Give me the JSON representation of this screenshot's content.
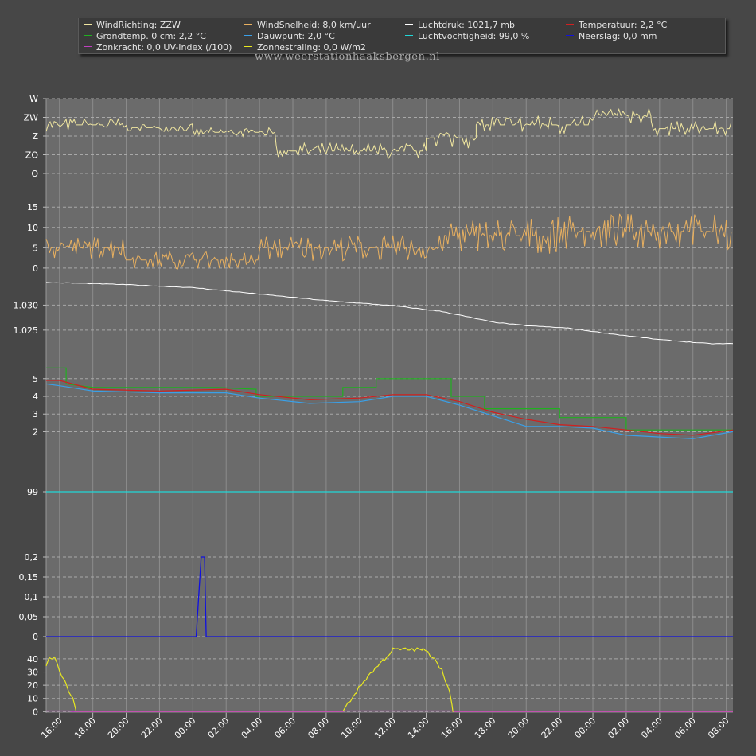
{
  "legend": [
    {
      "label": "WindRichting: ZZW",
      "color": "#f0e6a0"
    },
    {
      "label": "WindSnelheid: 8,0 km/uur",
      "color": "#e8b060"
    },
    {
      "label": "Luchtdruk: 1021,7 mb",
      "color": "#ffffff"
    },
    {
      "label": "Temperatuur: 2,2 °C",
      "color": "#d02020"
    },
    {
      "label": "Grondtemp. 0 cm: 2,2 °C",
      "color": "#20b020"
    },
    {
      "label": "Dauwpunt: 2,0 °C",
      "color": "#3aa0e8"
    },
    {
      "label": "Luchtvochtigheid: 99,0 %",
      "color": "#20d8d8"
    },
    {
      "label": "Neerslag: 0,0 mm",
      "color": "#1010e0"
    },
    {
      "label": "Zonkracht: 0,0 UV-Index (/100)",
      "color": "#c040c0"
    },
    {
      "label": "Zonnestraling: 0,0 W/m2",
      "color": "#e8e820"
    }
  ],
  "watermark": "www.weerstationhaaksbergen.nl",
  "colors": {
    "page_bg": "#474747",
    "panel_bg": "#6b6b6b",
    "grid": "#8c8c8c",
    "text": "#ffffff"
  },
  "chart_data": [
    {
      "type": "line",
      "name": "winddirection",
      "series_name": "WindRichting",
      "color": "#f0e6a0",
      "ytick_labels": [
        "O",
        "ZO",
        "Z",
        "ZW",
        "W"
      ],
      "ylim": [
        0,
        4
      ],
      "x_start_hour": 15.2,
      "x_end_hour": 56.4,
      "x_tick_labels": [
        "16:00",
        "18:00",
        "20:00",
        "22:00",
        "00:00",
        "02:00",
        "04:00",
        "06:00",
        "08:00",
        "10:00",
        "12:00",
        "14:00",
        "16:00",
        "18:00",
        "20:00",
        "22:00",
        "00:00",
        "02:00",
        "04:00",
        "06:00",
        "08:00"
      ],
      "segments": [
        {
          "x0": 15.2,
          "x1": 20.0,
          "level": 2.6,
          "noise": 0.35
        },
        {
          "x0": 20.0,
          "x1": 24.0,
          "level": 2.45,
          "noise": 0.2
        },
        {
          "x0": 24.0,
          "x1": 29.0,
          "level": 2.2,
          "noise": 0.25
        },
        {
          "x0": 29.0,
          "x1": 38.0,
          "level": 1.2,
          "noise": 0.45
        },
        {
          "x0": 38.0,
          "x1": 41.0,
          "level": 1.9,
          "noise": 0.55
        },
        {
          "x0": 41.0,
          "x1": 48.0,
          "level": 2.6,
          "noise": 0.55
        },
        {
          "x0": 48.0,
          "x1": 51.5,
          "level": 3.1,
          "noise": 0.45
        },
        {
          "x0": 51.5,
          "x1": 56.4,
          "level": 2.4,
          "noise": 0.4
        }
      ]
    },
    {
      "type": "line",
      "name": "windspeed",
      "series_name": "WindSnelheid",
      "color": "#e8b060",
      "yticks": [
        0,
        5,
        10,
        15
      ],
      "ylim": [
        -1,
        17
      ],
      "x_start_hour": 15.2,
      "x_end_hour": 56.4,
      "segments": [
        {
          "x0": 15.2,
          "x1": 20.0,
          "level": 5,
          "noise": 2.8
        },
        {
          "x0": 20.0,
          "x1": 28.0,
          "level": 2,
          "noise": 2.2
        },
        {
          "x0": 28.0,
          "x1": 39.0,
          "level": 5,
          "noise": 3.2
        },
        {
          "x0": 39.0,
          "x1": 46.0,
          "level": 8,
          "noise": 4.5
        },
        {
          "x0": 46.0,
          "x1": 56.4,
          "level": 9,
          "noise": 4.5
        }
      ]
    },
    {
      "type": "line",
      "name": "pressure",
      "series_name": "Luchtdruk",
      "color": "#ffffff",
      "ytick_labels": [
        "1.025",
        "1.030"
      ],
      "yticks": [
        1025,
        1030
      ],
      "ylim": [
        1021,
        1035
      ],
      "x": [
        15.2,
        17,
        20,
        24,
        28,
        32,
        36,
        39,
        42,
        44,
        46.5,
        49,
        52,
        55,
        56.4
      ],
      "values": [
        1034.5,
        1034.4,
        1034.1,
        1033.5,
        1032.2,
        1030.9,
        1029.9,
        1028.7,
        1026.6,
        1025.9,
        1025.4,
        1024.3,
        1023.1,
        1022.3,
        1022.3
      ]
    },
    {
      "type": "line",
      "name": "temperatures",
      "yticks": [
        2,
        3,
        4,
        5
      ],
      "ylim": [
        0.4,
        5.8
      ],
      "series": [
        {
          "name": "Grondtemp.",
          "color": "#20b020",
          "x": [
            15.2,
            16.4,
            16.4,
            18,
            25,
            25.5,
            27.8,
            27.8,
            33,
            33,
            35,
            35,
            39.5,
            39.5,
            41.5,
            41.5,
            46,
            46,
            50,
            50,
            56.4
          ],
          "values": [
            5.6,
            5.6,
            4.7,
            4.5,
            4.5,
            4.5,
            4.4,
            4.0,
            4.0,
            4.5,
            4.5,
            5.0,
            5.0,
            4.0,
            4.0,
            3.3,
            3.3,
            2.8,
            2.8,
            2.1,
            2.1
          ]
        },
        {
          "name": "Temperatuur",
          "color": "#d02020",
          "x": [
            15.2,
            16,
            18,
            22,
            26,
            28,
            31,
            34,
            36,
            38,
            40,
            42,
            44,
            46,
            48,
            50,
            52,
            54,
            56.4
          ],
          "values": [
            4.9,
            4.9,
            4.4,
            4.3,
            4.4,
            4.1,
            3.8,
            3.9,
            4.1,
            4.1,
            3.7,
            3.1,
            2.7,
            2.4,
            2.3,
            2.1,
            1.9,
            1.8,
            2.1
          ]
        },
        {
          "name": "Dauwpunt",
          "color": "#3aa0e8",
          "x": [
            15.2,
            16,
            18,
            22,
            26,
            28,
            31,
            34,
            36,
            38,
            40,
            42,
            44,
            46,
            48,
            50,
            52,
            54,
            56.4
          ],
          "values": [
            4.7,
            4.6,
            4.3,
            4.2,
            4.2,
            3.9,
            3.6,
            3.7,
            4.0,
            4.0,
            3.5,
            2.9,
            2.3,
            2.3,
            2.2,
            1.8,
            1.7,
            1.6,
            2.0
          ]
        }
      ]
    },
    {
      "type": "line",
      "name": "humidity",
      "series_name": "Luchtvochtigheid",
      "color": "#20d8d8",
      "yticks": [
        99
      ],
      "ylim": [
        95,
        101
      ],
      "x": [
        15.2,
        56.4
      ],
      "values": [
        99,
        99
      ]
    },
    {
      "type": "line",
      "name": "rain",
      "series_name": "Neerslag",
      "color": "#1010e0",
      "ytick_labels": [
        "0",
        "0,05",
        "0,1",
        "0,15",
        "0,2"
      ],
      "yticks": [
        0,
        0.05,
        0.1,
        0.15,
        0.2
      ],
      "ylim": [
        0,
        0.22
      ],
      "x": [
        15.2,
        24.2,
        24.5,
        24.7,
        24.8,
        56.4
      ],
      "values": [
        0,
        0,
        0.2,
        0.2,
        0,
        0
      ]
    },
    {
      "type": "line",
      "name": "solar",
      "yticks": [
        0,
        10,
        20,
        30,
        40
      ],
      "ylim": [
        -1,
        52
      ],
      "series": [
        {
          "name": "Zonnestraling",
          "color": "#e8e820",
          "x": [
            15.2,
            15.4,
            15.7,
            16.0,
            16.4,
            16.8,
            17.0,
            33.0,
            33.3,
            33.8,
            34.5,
            35.5,
            36.0,
            37.0,
            37.8,
            38.5,
            39.0,
            39.4,
            39.6,
            56.4
          ],
          "values": [
            36,
            40,
            40,
            32,
            20,
            10,
            0,
            0,
            6,
            15,
            27,
            40,
            47,
            47,
            47,
            41,
            30,
            15,
            0,
            0
          ]
        },
        {
          "name": "Zonkracht",
          "color": "#c040c0",
          "x": [
            15.2,
            16.6,
            16.7,
            33.0,
            33.1,
            39.6,
            39.7,
            56.4
          ],
          "values": [
            0.5,
            0.5,
            0,
            0,
            0.5,
            0.5,
            0,
            0
          ]
        }
      ]
    }
  ]
}
